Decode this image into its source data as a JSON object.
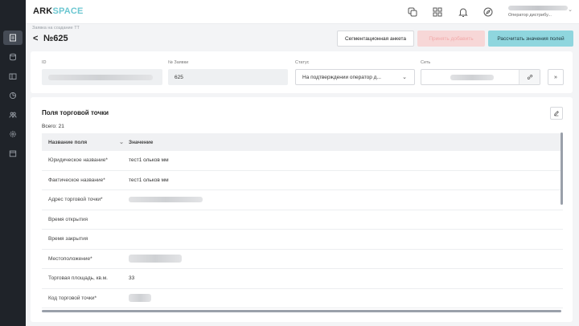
{
  "app": {
    "logo_ark": "ARK",
    "logo_space": "SPACE",
    "user_role": "Оператор дистрибу..."
  },
  "colors": {
    "sidebar_bg": "#1f2329",
    "accent": "#8fd6de",
    "disabled_btn": "#f7d7d7"
  },
  "sidebar": {
    "items": [
      {
        "icon": "document-icon",
        "active": true
      },
      {
        "icon": "database-icon",
        "active": false
      },
      {
        "icon": "folder-icon",
        "active": false
      },
      {
        "icon": "pie-chart-icon",
        "active": false
      },
      {
        "icon": "users-icon",
        "active": false
      },
      {
        "icon": "settings-icon",
        "active": false
      },
      {
        "icon": "calendar-icon",
        "active": false
      }
    ]
  },
  "topbar": {
    "icons": [
      "copy-icon",
      "grid-icon",
      "bell-icon",
      "compass-icon"
    ]
  },
  "page": {
    "breadcrumb": "Заявка на создание ТТ",
    "back": "<",
    "title": "№625"
  },
  "actions": {
    "segment_label": "Сегментационная анкета",
    "disabled_label": "Принять добавить",
    "calc_label": "Рассчитать значения полей"
  },
  "header_fields": {
    "id_label": "ID",
    "request_label": "№ Заявки",
    "request_value": "625",
    "status_label": "Статус",
    "status_value": "На подтверждении оператор д...",
    "network_label": "Сеть"
  },
  "section": {
    "title": "Поля торговой точки",
    "total": "Всего: 21",
    "col_name": "Название поля",
    "col_value": "Значение"
  },
  "rows": [
    {
      "name": "Юридическое название*",
      "value": "тест1 ольков мм"
    },
    {
      "name": "Фактическое название*",
      "value": "тест1 ольков мм"
    },
    {
      "name": "Адрес торговой точки*",
      "value": ""
    },
    {
      "name": "Время открытия",
      "value": ""
    },
    {
      "name": "Время закрытия",
      "value": ""
    },
    {
      "name": "Местоположение*",
      "value": ""
    },
    {
      "name": "Торговая площадь, кв.м.",
      "value": "33"
    },
    {
      "name": "Код торговой точки*",
      "value": ""
    }
  ]
}
